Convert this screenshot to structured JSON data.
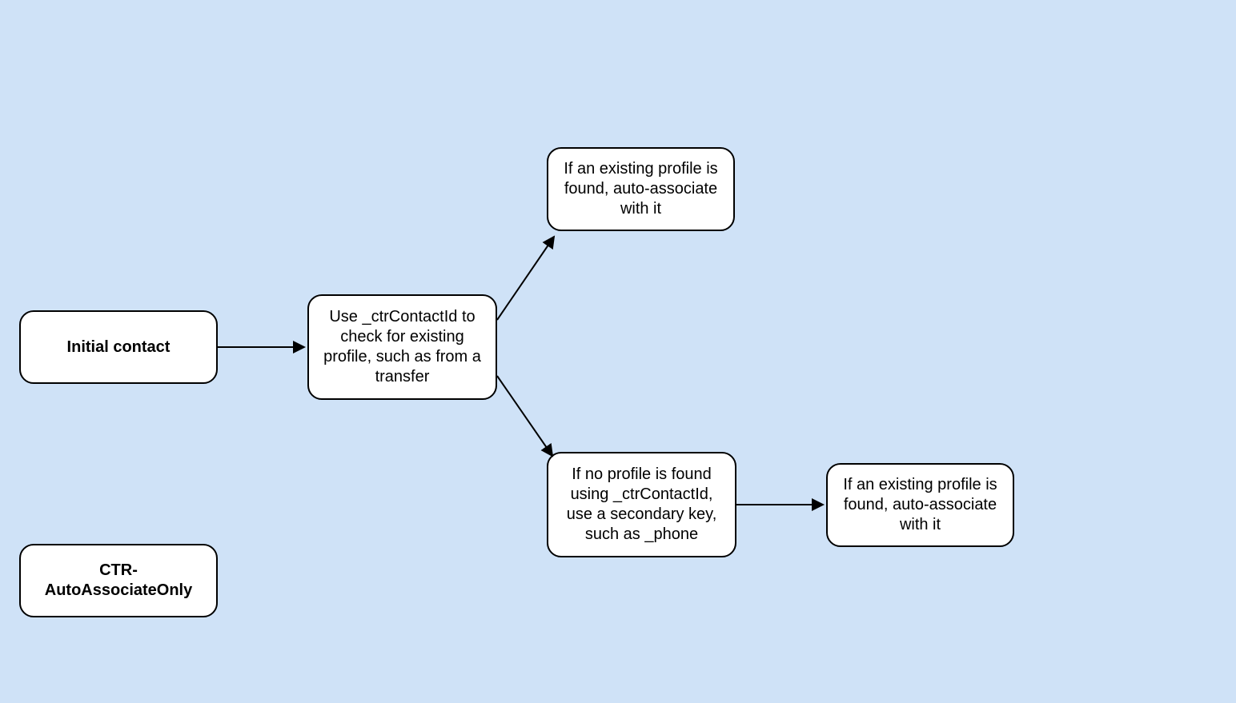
{
  "nodes": {
    "initial_contact": {
      "label": "Initial contact"
    },
    "check_profile": {
      "label": "Use _ctrContactId to check for existing profile, such as from a transfer"
    },
    "found_assoc_1": {
      "label": "If an existing profile is found, auto-associate with it"
    },
    "not_found_secondary": {
      "label": "If no profile is found using _ctrContactId, use a secondary key, such as _phone"
    },
    "found_assoc_2": {
      "label": "If an existing profile is found, auto-associate with it"
    },
    "legend": {
      "label": "CTR-AutoAssociateOnly"
    }
  }
}
